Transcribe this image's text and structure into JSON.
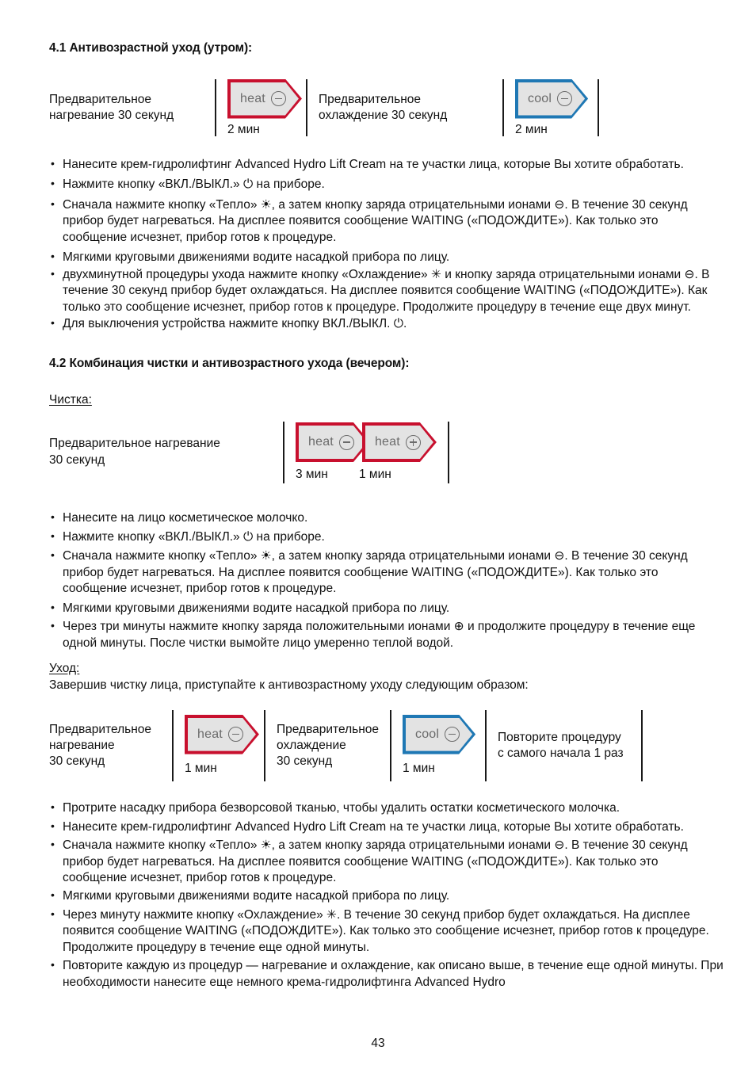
{
  "page_number": "43",
  "colors": {
    "heat_border": "#c8102e",
    "cool_border": "#1f78b4",
    "badge_fill": "#e3e3e3",
    "badge_text": "#6b6b6b",
    "body_text": "#111111"
  },
  "section_41": {
    "title": "4.1 Антивозрастной уход (утром):",
    "diagram": {
      "columns": [
        {
          "kind": "text",
          "lines": [
            "Предварительное",
            "нагревание 30 секунд"
          ]
        },
        {
          "kind": "badge",
          "label": "heat",
          "sign": "minus",
          "style": "red",
          "minutes": "2 мин"
        },
        {
          "kind": "text",
          "lines": [
            "Предварительное",
            "охлаждение 30 секунд"
          ]
        },
        {
          "kind": "badge",
          "label": "cool",
          "sign": "minus",
          "style": "blue",
          "minutes": "2 мин"
        }
      ]
    },
    "bullets": [
      "Нанесите крем-гидролифтинг Advanced Hydro Lift Cream на те участки лица, которые Вы хотите обработать.",
      "Нажмите кнопку «ВКЛ./ВЫКЛ.» ⏻ на приборе.",
      "Сначала нажмите кнопку «Тепло» ☀, а затем кнопку заряда отрицательными ионами ⊖. В течение 30 секунд прибор будет нагреваться. На дисплее появится сообщение WAITING («ПОДОЖДИТЕ»). Как только это сообщение исчезнет, прибор готов к процедуре.",
      "Мягкими круговыми движениями водите насадкой прибора по лицу.",
      "двухминутной процедуры ухода нажмите кнопку «Охлаждение» ✳ и кнопку заряда отрицательными ионами ⊖. В течение 30 секунд прибор будет охлаждаться. На дисплее появится сообщение WAITING («ПОДОЖДИТЕ»). Как только это сообщение исчезнет, прибор готов к процедуре. Продолжите процедуру в течение еще двух минут.",
      "Для выключения устройства нажмите кнопку ВКЛ./ВЫКЛ. ⏻."
    ]
  },
  "section_42": {
    "title": "4.2 Комбинация чистки и антивозрастного ухода (вечером):",
    "cleaning_subhead": "Чистка:",
    "cleaning_diagram": {
      "columns": [
        {
          "kind": "text",
          "lines": [
            "Предварительное нагревание",
            "30 секунд"
          ]
        },
        {
          "kind": "badge_pair",
          "badges": [
            {
              "label": "heat",
              "sign": "minus",
              "style": "red",
              "minutes": "3 мин"
            },
            {
              "label": "heat",
              "sign": "plus",
              "style": "red",
              "minutes": "1 мин"
            }
          ]
        }
      ]
    },
    "cleaning_bullets": [
      "Нанесите на лицо косметическое молочко.",
      "Нажмите кнопку «ВКЛ./ВЫКЛ.» ⏻ на приборе.",
      "Сначала нажмите кнопку «Тепло» ☀, а затем кнопку заряда отрицательными ионами ⊖. В течение 30 секунд прибор будет нагреваться. На дисплее появится сообщение WAITING («ПОДОЖДИТЕ»). Как только это сообщение исчезнет, прибор готов к процедуре.",
      "Мягкими круговыми движениями водите насадкой прибора по лицу.",
      "Через три минуты нажмите кнопку заряда положительными ионами ⊕ и продолжите процедуру в течение еще одной минуты. После чистки вымойте лицо умеренно теплой водой."
    ],
    "care_subhead": "Уход:",
    "care_intro": "Завершив чистку лица, приступайте к антивозрастному уходу следующим образом:",
    "care_diagram": {
      "columns": [
        {
          "kind": "text",
          "lines": [
            "Предварительное",
            "нагревание",
            "30 секунд"
          ]
        },
        {
          "kind": "badge",
          "label": "heat",
          "sign": "minus",
          "style": "red",
          "minutes": "1 мин"
        },
        {
          "kind": "text",
          "lines": [
            "Предварительное",
            "охлаждение",
            "30 секунд"
          ]
        },
        {
          "kind": "badge",
          "label": "cool",
          "sign": "minus",
          "style": "blue",
          "minutes": "1 мин"
        },
        {
          "kind": "text",
          "lines": [
            "Повторите процедуру",
            "с самого начала 1 раз"
          ]
        }
      ]
    },
    "care_bullets": [
      "Протрите насадку прибора безворсовой тканью, чтобы удалить остатки косметического молочка.",
      "Нанесите крем-гидролифтинг Advanced Hydro Lift Cream на те участки лица, которые Вы хотите обработать.",
      "Сначала нажмите кнопку «Тепло» ☀, а затем кнопку заряда отрицательными ионами ⊖. В течение 30 секунд прибор будет нагреваться. На дисплее появится сообщение WAITING («ПОДОЖДИТЕ»). Как только это сообщение исчезнет, прибор готов к процедуре.",
      "Мягкими круговыми движениями водите насадкой прибора по лицу.",
      "Через минуту нажмите кнопку «Охлаждение» ✳. В течение 30 секунд прибор будет охлаждаться. На дисплее появится сообщение WAITING («ПОДОЖДИТЕ»). Как только это сообщение исчезнет, прибор готов к процедуре. Продолжите процедуру в течение еще одной минуты.",
      "Повторите каждую из процедур — нагревание и охлаждение, как описано выше, в течение еще одной минуты. При необходимости нанесите еще немного крема-гидролифтинга Advanced Hydro"
    ]
  }
}
